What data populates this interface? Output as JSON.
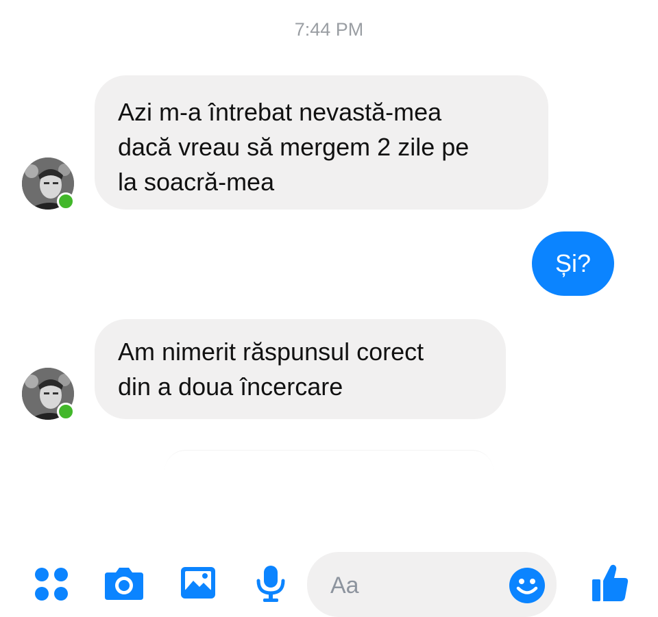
{
  "timestamp": "7:44 PM",
  "messages": [
    {
      "direction": "incoming",
      "lines": [
        "Azi m-a întrebat nevastă-mea",
        "dacă vreau să mergem 2 zile pe",
        "la soacră-mea"
      ],
      "sender_online": true
    },
    {
      "direction": "outgoing",
      "text": "Și?"
    },
    {
      "direction": "incoming",
      "lines": [
        "Am nimerit răspunsul corect",
        "din a doua încercare"
      ],
      "sender_online": true
    }
  ],
  "composer": {
    "placeholder": "Aa",
    "icons": [
      "more-icon",
      "camera-icon",
      "photo-icon",
      "microphone-icon",
      "emoji-icon",
      "like-icon"
    ]
  },
  "colors": {
    "accent": "#0b84ff",
    "incoming_bubble": "#f1f0f0",
    "online": "#42b72a",
    "timestamp": "#9a9ea3"
  }
}
